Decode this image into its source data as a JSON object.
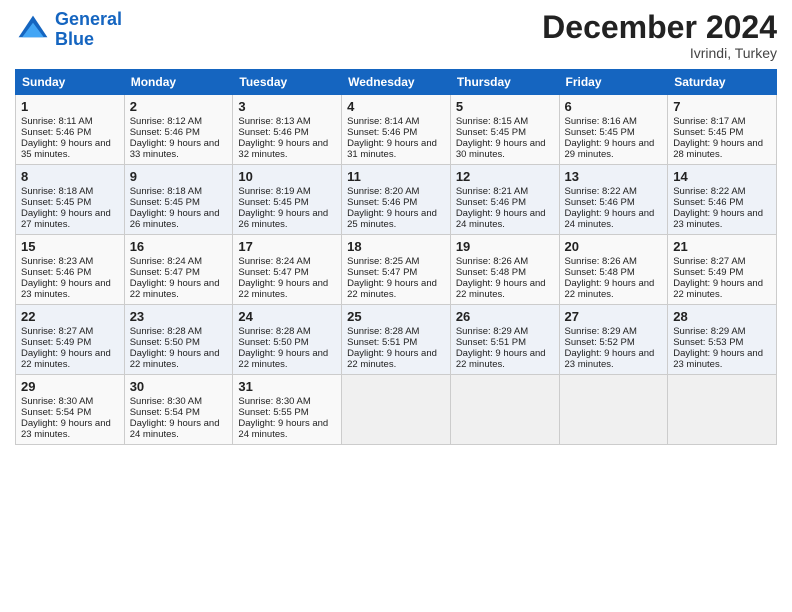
{
  "logo": {
    "line1": "General",
    "line2": "Blue"
  },
  "header": {
    "month": "December 2024",
    "location": "Ivrindi, Turkey"
  },
  "days_of_week": [
    "Sunday",
    "Monday",
    "Tuesday",
    "Wednesday",
    "Thursday",
    "Friday",
    "Saturday"
  ],
  "weeks": [
    [
      {
        "day": 1,
        "sunrise": "Sunrise: 8:11 AM",
        "sunset": "Sunset: 5:46 PM",
        "daylight": "Daylight: 9 hours and 35 minutes."
      },
      {
        "day": 2,
        "sunrise": "Sunrise: 8:12 AM",
        "sunset": "Sunset: 5:46 PM",
        "daylight": "Daylight: 9 hours and 33 minutes."
      },
      {
        "day": 3,
        "sunrise": "Sunrise: 8:13 AM",
        "sunset": "Sunset: 5:46 PM",
        "daylight": "Daylight: 9 hours and 32 minutes."
      },
      {
        "day": 4,
        "sunrise": "Sunrise: 8:14 AM",
        "sunset": "Sunset: 5:46 PM",
        "daylight": "Daylight: 9 hours and 31 minutes."
      },
      {
        "day": 5,
        "sunrise": "Sunrise: 8:15 AM",
        "sunset": "Sunset: 5:45 PM",
        "daylight": "Daylight: 9 hours and 30 minutes."
      },
      {
        "day": 6,
        "sunrise": "Sunrise: 8:16 AM",
        "sunset": "Sunset: 5:45 PM",
        "daylight": "Daylight: 9 hours and 29 minutes."
      },
      {
        "day": 7,
        "sunrise": "Sunrise: 8:17 AM",
        "sunset": "Sunset: 5:45 PM",
        "daylight": "Daylight: 9 hours and 28 minutes."
      }
    ],
    [
      {
        "day": 8,
        "sunrise": "Sunrise: 8:18 AM",
        "sunset": "Sunset: 5:45 PM",
        "daylight": "Daylight: 9 hours and 27 minutes."
      },
      {
        "day": 9,
        "sunrise": "Sunrise: 8:18 AM",
        "sunset": "Sunset: 5:45 PM",
        "daylight": "Daylight: 9 hours and 26 minutes."
      },
      {
        "day": 10,
        "sunrise": "Sunrise: 8:19 AM",
        "sunset": "Sunset: 5:45 PM",
        "daylight": "Daylight: 9 hours and 26 minutes."
      },
      {
        "day": 11,
        "sunrise": "Sunrise: 8:20 AM",
        "sunset": "Sunset: 5:46 PM",
        "daylight": "Daylight: 9 hours and 25 minutes."
      },
      {
        "day": 12,
        "sunrise": "Sunrise: 8:21 AM",
        "sunset": "Sunset: 5:46 PM",
        "daylight": "Daylight: 9 hours and 24 minutes."
      },
      {
        "day": 13,
        "sunrise": "Sunrise: 8:22 AM",
        "sunset": "Sunset: 5:46 PM",
        "daylight": "Daylight: 9 hours and 24 minutes."
      },
      {
        "day": 14,
        "sunrise": "Sunrise: 8:22 AM",
        "sunset": "Sunset: 5:46 PM",
        "daylight": "Daylight: 9 hours and 23 minutes."
      }
    ],
    [
      {
        "day": 15,
        "sunrise": "Sunrise: 8:23 AM",
        "sunset": "Sunset: 5:46 PM",
        "daylight": "Daylight: 9 hours and 23 minutes."
      },
      {
        "day": 16,
        "sunrise": "Sunrise: 8:24 AM",
        "sunset": "Sunset: 5:47 PM",
        "daylight": "Daylight: 9 hours and 22 minutes."
      },
      {
        "day": 17,
        "sunrise": "Sunrise: 8:24 AM",
        "sunset": "Sunset: 5:47 PM",
        "daylight": "Daylight: 9 hours and 22 minutes."
      },
      {
        "day": 18,
        "sunrise": "Sunrise: 8:25 AM",
        "sunset": "Sunset: 5:47 PM",
        "daylight": "Daylight: 9 hours and 22 minutes."
      },
      {
        "day": 19,
        "sunrise": "Sunrise: 8:26 AM",
        "sunset": "Sunset: 5:48 PM",
        "daylight": "Daylight: 9 hours and 22 minutes."
      },
      {
        "day": 20,
        "sunrise": "Sunrise: 8:26 AM",
        "sunset": "Sunset: 5:48 PM",
        "daylight": "Daylight: 9 hours and 22 minutes."
      },
      {
        "day": 21,
        "sunrise": "Sunrise: 8:27 AM",
        "sunset": "Sunset: 5:49 PM",
        "daylight": "Daylight: 9 hours and 22 minutes."
      }
    ],
    [
      {
        "day": 22,
        "sunrise": "Sunrise: 8:27 AM",
        "sunset": "Sunset: 5:49 PM",
        "daylight": "Daylight: 9 hours and 22 minutes."
      },
      {
        "day": 23,
        "sunrise": "Sunrise: 8:28 AM",
        "sunset": "Sunset: 5:50 PM",
        "daylight": "Daylight: 9 hours and 22 minutes."
      },
      {
        "day": 24,
        "sunrise": "Sunrise: 8:28 AM",
        "sunset": "Sunset: 5:50 PM",
        "daylight": "Daylight: 9 hours and 22 minutes."
      },
      {
        "day": 25,
        "sunrise": "Sunrise: 8:28 AM",
        "sunset": "Sunset: 5:51 PM",
        "daylight": "Daylight: 9 hours and 22 minutes."
      },
      {
        "day": 26,
        "sunrise": "Sunrise: 8:29 AM",
        "sunset": "Sunset: 5:51 PM",
        "daylight": "Daylight: 9 hours and 22 minutes."
      },
      {
        "day": 27,
        "sunrise": "Sunrise: 8:29 AM",
        "sunset": "Sunset: 5:52 PM",
        "daylight": "Daylight: 9 hours and 23 minutes."
      },
      {
        "day": 28,
        "sunrise": "Sunrise: 8:29 AM",
        "sunset": "Sunset: 5:53 PM",
        "daylight": "Daylight: 9 hours and 23 minutes."
      }
    ],
    [
      {
        "day": 29,
        "sunrise": "Sunrise: 8:30 AM",
        "sunset": "Sunset: 5:54 PM",
        "daylight": "Daylight: 9 hours and 23 minutes."
      },
      {
        "day": 30,
        "sunrise": "Sunrise: 8:30 AM",
        "sunset": "Sunset: 5:54 PM",
        "daylight": "Daylight: 9 hours and 24 minutes."
      },
      {
        "day": 31,
        "sunrise": "Sunrise: 8:30 AM",
        "sunset": "Sunset: 5:55 PM",
        "daylight": "Daylight: 9 hours and 24 minutes."
      },
      null,
      null,
      null,
      null
    ]
  ]
}
